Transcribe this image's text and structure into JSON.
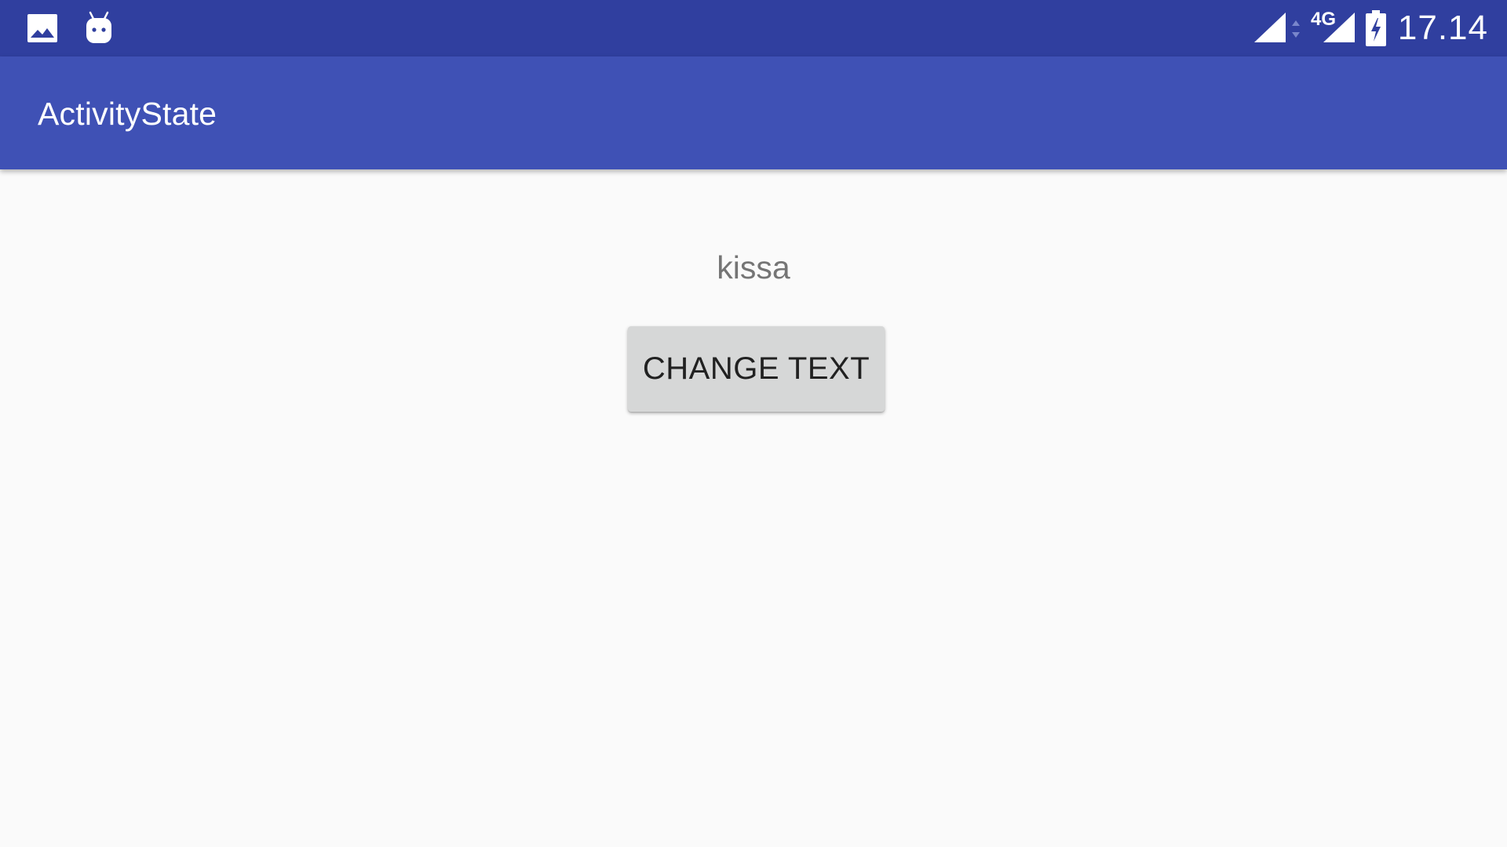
{
  "status_bar": {
    "time": "17.14",
    "network_type": "4G",
    "left_icons": [
      "image-notification-icon",
      "android-debug-icon"
    ],
    "right_icons": [
      "signal-icon",
      "data-activity-icon",
      "signal-4g-icon",
      "battery-charging-icon"
    ],
    "color": "#303f9f"
  },
  "app_bar": {
    "title": "ActivityState",
    "color": "#3f51b5"
  },
  "content": {
    "text_value": "kissa",
    "button_label": "CHANGE TEXT"
  }
}
